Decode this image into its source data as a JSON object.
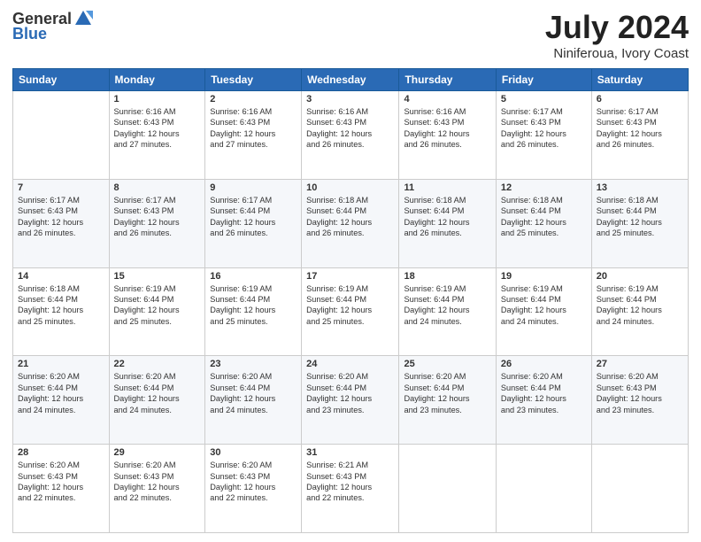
{
  "logo": {
    "general": "General",
    "blue": "Blue"
  },
  "header": {
    "title": "July 2024",
    "subtitle": "Niniferoua, Ivory Coast"
  },
  "weekdays": [
    "Sunday",
    "Monday",
    "Tuesday",
    "Wednesday",
    "Thursday",
    "Friday",
    "Saturday"
  ],
  "weeks": [
    [
      {
        "day": "",
        "info": ""
      },
      {
        "day": "1",
        "info": "Sunrise: 6:16 AM\nSunset: 6:43 PM\nDaylight: 12 hours\nand 27 minutes."
      },
      {
        "day": "2",
        "info": "Sunrise: 6:16 AM\nSunset: 6:43 PM\nDaylight: 12 hours\nand 27 minutes."
      },
      {
        "day": "3",
        "info": "Sunrise: 6:16 AM\nSunset: 6:43 PM\nDaylight: 12 hours\nand 26 minutes."
      },
      {
        "day": "4",
        "info": "Sunrise: 6:16 AM\nSunset: 6:43 PM\nDaylight: 12 hours\nand 26 minutes."
      },
      {
        "day": "5",
        "info": "Sunrise: 6:17 AM\nSunset: 6:43 PM\nDaylight: 12 hours\nand 26 minutes."
      },
      {
        "day": "6",
        "info": "Sunrise: 6:17 AM\nSunset: 6:43 PM\nDaylight: 12 hours\nand 26 minutes."
      }
    ],
    [
      {
        "day": "7",
        "info": "Sunrise: 6:17 AM\nSunset: 6:43 PM\nDaylight: 12 hours\nand 26 minutes."
      },
      {
        "day": "8",
        "info": "Sunrise: 6:17 AM\nSunset: 6:43 PM\nDaylight: 12 hours\nand 26 minutes."
      },
      {
        "day": "9",
        "info": "Sunrise: 6:17 AM\nSunset: 6:44 PM\nDaylight: 12 hours\nand 26 minutes."
      },
      {
        "day": "10",
        "info": "Sunrise: 6:18 AM\nSunset: 6:44 PM\nDaylight: 12 hours\nand 26 minutes."
      },
      {
        "day": "11",
        "info": "Sunrise: 6:18 AM\nSunset: 6:44 PM\nDaylight: 12 hours\nand 26 minutes."
      },
      {
        "day": "12",
        "info": "Sunrise: 6:18 AM\nSunset: 6:44 PM\nDaylight: 12 hours\nand 25 minutes."
      },
      {
        "day": "13",
        "info": "Sunrise: 6:18 AM\nSunset: 6:44 PM\nDaylight: 12 hours\nand 25 minutes."
      }
    ],
    [
      {
        "day": "14",
        "info": "Sunrise: 6:18 AM\nSunset: 6:44 PM\nDaylight: 12 hours\nand 25 minutes."
      },
      {
        "day": "15",
        "info": "Sunrise: 6:19 AM\nSunset: 6:44 PM\nDaylight: 12 hours\nand 25 minutes."
      },
      {
        "day": "16",
        "info": "Sunrise: 6:19 AM\nSunset: 6:44 PM\nDaylight: 12 hours\nand 25 minutes."
      },
      {
        "day": "17",
        "info": "Sunrise: 6:19 AM\nSunset: 6:44 PM\nDaylight: 12 hours\nand 25 minutes."
      },
      {
        "day": "18",
        "info": "Sunrise: 6:19 AM\nSunset: 6:44 PM\nDaylight: 12 hours\nand 24 minutes."
      },
      {
        "day": "19",
        "info": "Sunrise: 6:19 AM\nSunset: 6:44 PM\nDaylight: 12 hours\nand 24 minutes."
      },
      {
        "day": "20",
        "info": "Sunrise: 6:19 AM\nSunset: 6:44 PM\nDaylight: 12 hours\nand 24 minutes."
      }
    ],
    [
      {
        "day": "21",
        "info": "Sunrise: 6:20 AM\nSunset: 6:44 PM\nDaylight: 12 hours\nand 24 minutes."
      },
      {
        "day": "22",
        "info": "Sunrise: 6:20 AM\nSunset: 6:44 PM\nDaylight: 12 hours\nand 24 minutes."
      },
      {
        "day": "23",
        "info": "Sunrise: 6:20 AM\nSunset: 6:44 PM\nDaylight: 12 hours\nand 24 minutes."
      },
      {
        "day": "24",
        "info": "Sunrise: 6:20 AM\nSunset: 6:44 PM\nDaylight: 12 hours\nand 23 minutes."
      },
      {
        "day": "25",
        "info": "Sunrise: 6:20 AM\nSunset: 6:44 PM\nDaylight: 12 hours\nand 23 minutes."
      },
      {
        "day": "26",
        "info": "Sunrise: 6:20 AM\nSunset: 6:44 PM\nDaylight: 12 hours\nand 23 minutes."
      },
      {
        "day": "27",
        "info": "Sunrise: 6:20 AM\nSunset: 6:43 PM\nDaylight: 12 hours\nand 23 minutes."
      }
    ],
    [
      {
        "day": "28",
        "info": "Sunrise: 6:20 AM\nSunset: 6:43 PM\nDaylight: 12 hours\nand 22 minutes."
      },
      {
        "day": "29",
        "info": "Sunrise: 6:20 AM\nSunset: 6:43 PM\nDaylight: 12 hours\nand 22 minutes."
      },
      {
        "day": "30",
        "info": "Sunrise: 6:20 AM\nSunset: 6:43 PM\nDaylight: 12 hours\nand 22 minutes."
      },
      {
        "day": "31",
        "info": "Sunrise: 6:21 AM\nSunset: 6:43 PM\nDaylight: 12 hours\nand 22 minutes."
      },
      {
        "day": "",
        "info": ""
      },
      {
        "day": "",
        "info": ""
      },
      {
        "day": "",
        "info": ""
      }
    ]
  ]
}
